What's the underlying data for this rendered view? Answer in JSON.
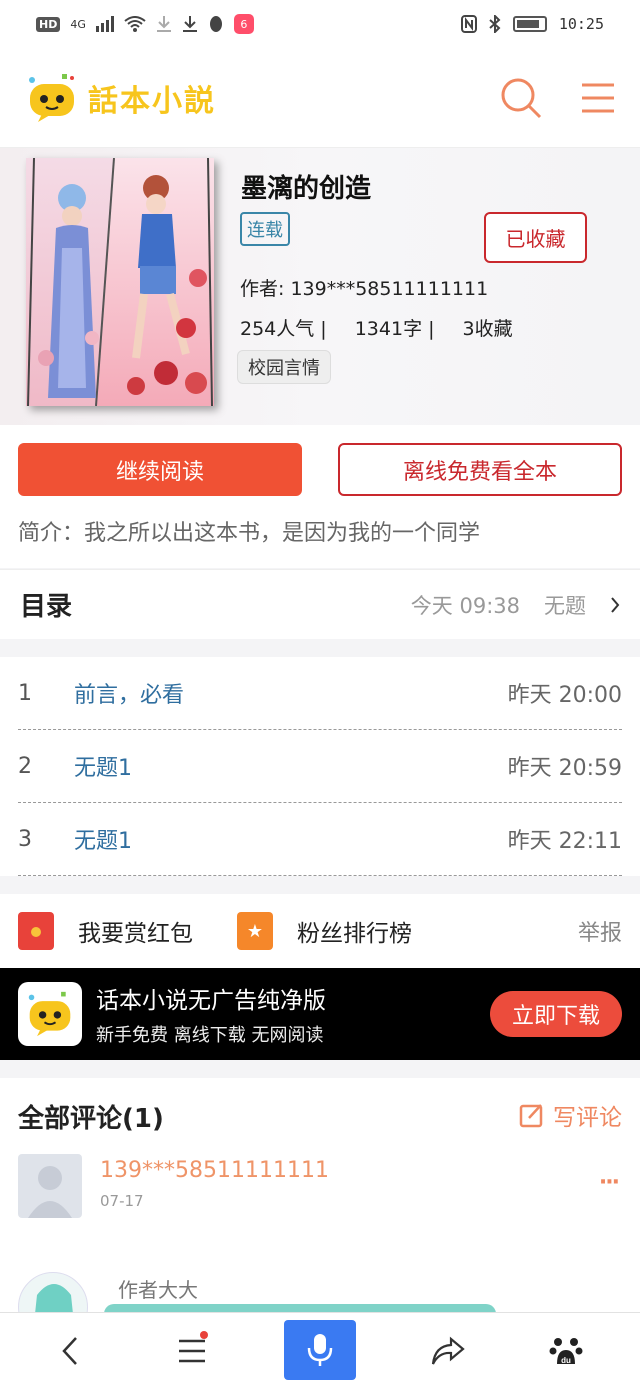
{
  "status_bar": {
    "hd": "HD",
    "network": "4G",
    "time": "10:25"
  },
  "header": {
    "logo_text": "話本小説",
    "actions": [
      "search-icon",
      "menu-icon"
    ]
  },
  "book": {
    "title": "墨漓的创造",
    "status_tag": "连载",
    "favorite_label": "已收藏",
    "author": "作者: 139***58511111111",
    "popularity": "254人气 |",
    "words": "1341字 |",
    "favorites": "3收藏",
    "genre": "校园言情"
  },
  "actions": {
    "read_label": "继续阅读",
    "offline_label": "离线免费看全本",
    "intro": "简介：我之所以出这本书，是因为我的一个同学"
  },
  "toc": {
    "title": "目录",
    "latest_time": "今天 09:38",
    "latest_title": "无题",
    "chapters": [
      {
        "num": "1",
        "name": "前言，必看",
        "time": "昨天 20:00"
      },
      {
        "num": "2",
        "name": "无题1",
        "time": "昨天 20:59"
      },
      {
        "num": "3",
        "name": "无题1",
        "time": "昨天 22:11"
      }
    ]
  },
  "reward": {
    "red_packet": "我要赏红包",
    "fan_rank": "粉丝排行榜",
    "report": "举报"
  },
  "ad": {
    "title": "话本小说无广告纯净版",
    "subtitle": "新手免费 离线下载 无网阅读",
    "button": "立即下载"
  },
  "comments": {
    "title": "全部评论(1)",
    "write_label": "写评论",
    "items": [
      {
        "user": "139***58511111111",
        "date": "07-17",
        "more": "···"
      }
    ],
    "reply_label": "作者大大"
  },
  "colors": {
    "accent_red": "#f05134",
    "link_blue": "#2f6e9f",
    "logo_yellow": "#f7c51d",
    "header_orange": "#ef8861",
    "mic_blue": "#3a7af2"
  }
}
